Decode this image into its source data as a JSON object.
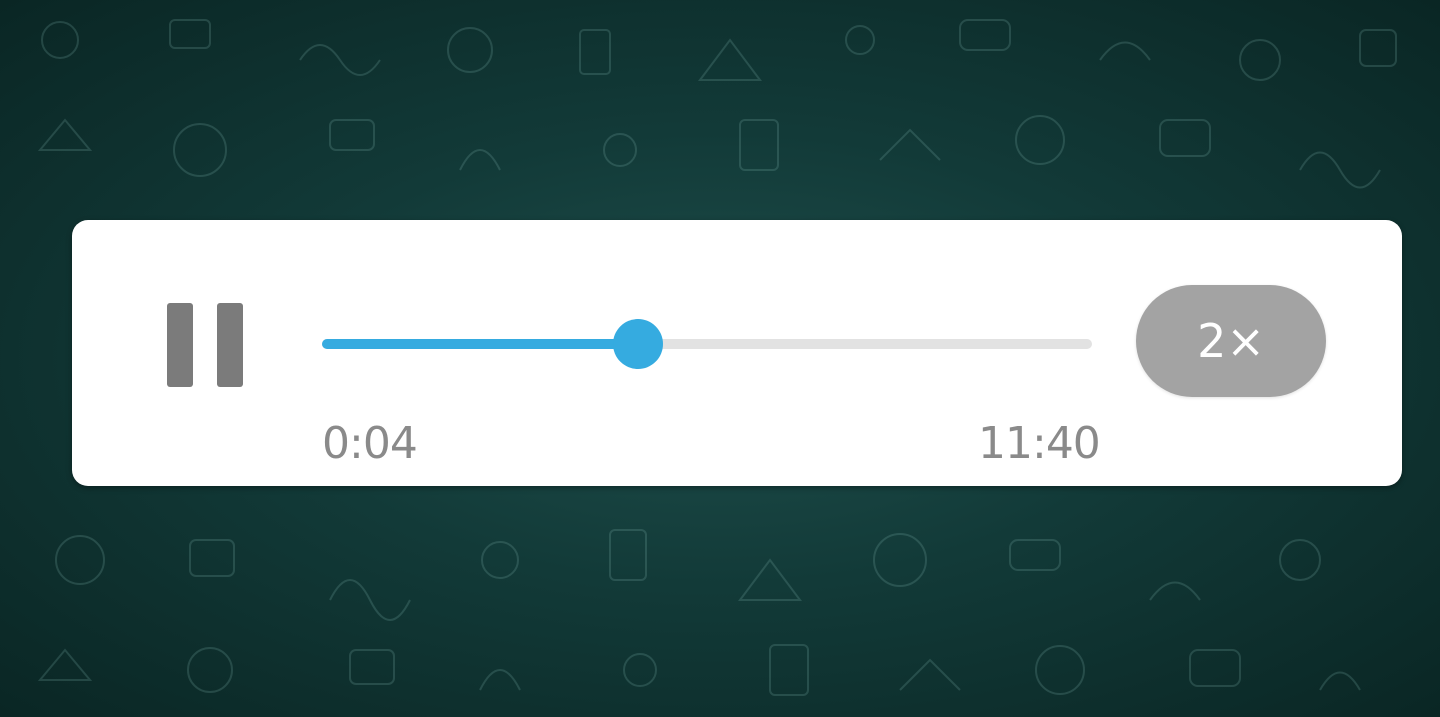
{
  "background": {
    "pattern": "chat-doodle-wallpaper-icon",
    "color": "#123a38"
  },
  "player": {
    "pause_icon": "pause-icon",
    "progress": 0.41,
    "current_time": "0:04",
    "total_time": "11:40",
    "speed_label": "2×",
    "accent_color": "#35abe0",
    "track_color": "#e2e2e2",
    "speed_button_color": "#a3a3a3"
  }
}
